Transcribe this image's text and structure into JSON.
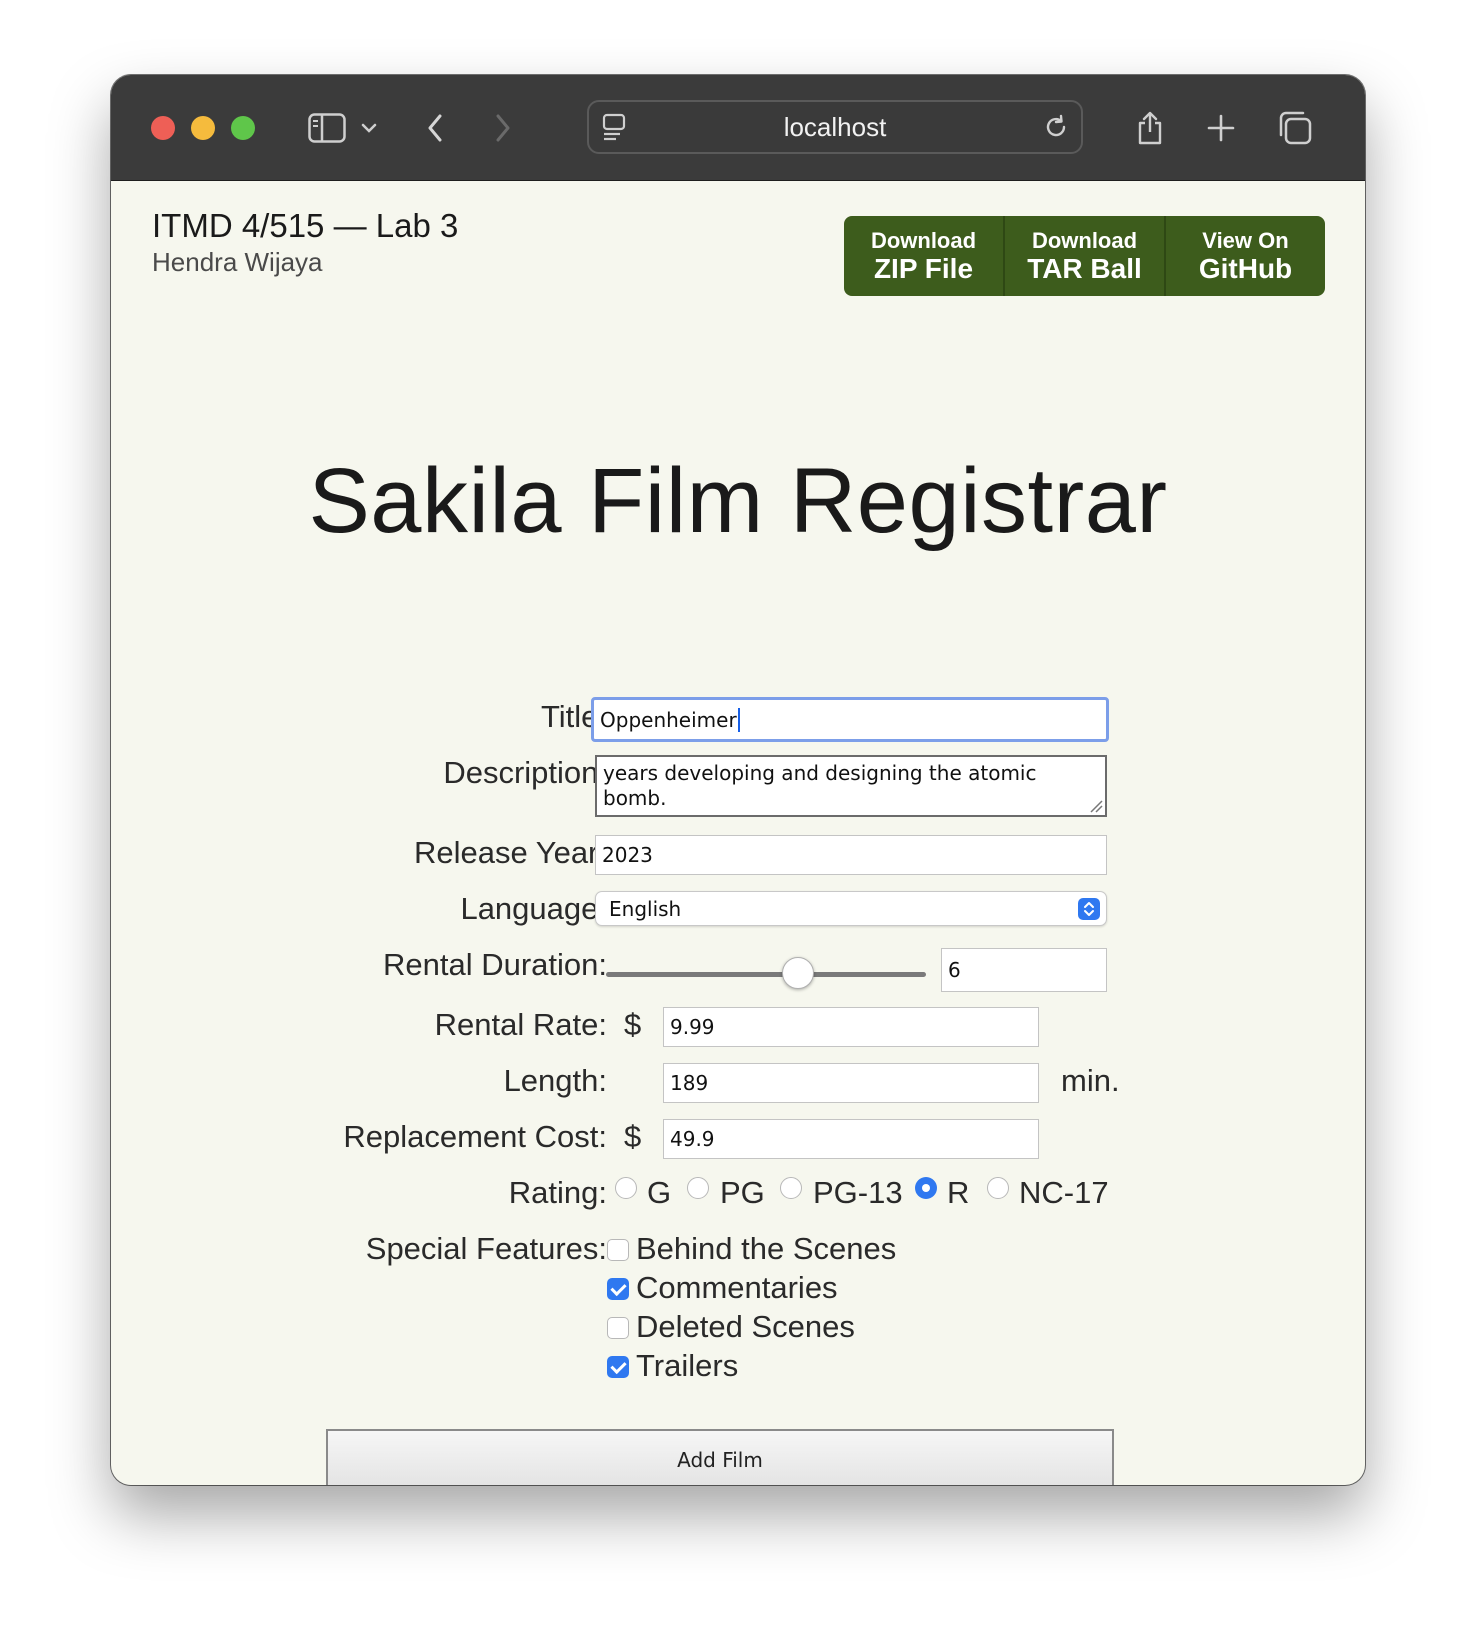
{
  "browser": {
    "url": "localhost"
  },
  "header": {
    "title": "ITMD 4/515 — Lab 3",
    "author": "Hendra Wijaya",
    "buttons": [
      {
        "small": "Download",
        "big": "ZIP File"
      },
      {
        "small": "Download",
        "big": "TAR Ball"
      },
      {
        "small": "View On",
        "big": "GitHub"
      }
    ]
  },
  "form": {
    "heading": "Sakila Film Registrar",
    "title": {
      "label": "Title:",
      "value": "Oppenheimer"
    },
    "description": {
      "label": "Description:",
      "value": "years developing and designing the atomic bomb."
    },
    "release_year": {
      "label": "Release Year:",
      "value": "2023"
    },
    "language": {
      "label": "Language:",
      "value": "English"
    },
    "rental_duration": {
      "label": "Rental Duration:",
      "value": "6",
      "slider_fraction": 0.6
    },
    "rental_rate": {
      "label": "Rental Rate:",
      "prefix": "$",
      "value": "9.99"
    },
    "length": {
      "label": "Length:",
      "value": "189",
      "suffix": "min."
    },
    "replacement_cost": {
      "label": "Replacement Cost:",
      "prefix": "$",
      "value": "49.9"
    },
    "rating": {
      "label": "Rating:",
      "options": [
        "G",
        "PG",
        "PG-13",
        "R",
        "NC-17"
      ],
      "selected": "R"
    },
    "special_features": {
      "label": "Special Features:",
      "options": [
        {
          "label": "Behind the Scenes",
          "checked": false
        },
        {
          "label": "Commentaries",
          "checked": true
        },
        {
          "label": "Deleted Scenes",
          "checked": false
        },
        {
          "label": "Trailers",
          "checked": true
        }
      ]
    },
    "submit_label": "Add Film"
  },
  "colors": {
    "page_bg": "#f6f7ee",
    "button_green": "#3d5c1c",
    "accent_blue": "#2f78f0"
  }
}
